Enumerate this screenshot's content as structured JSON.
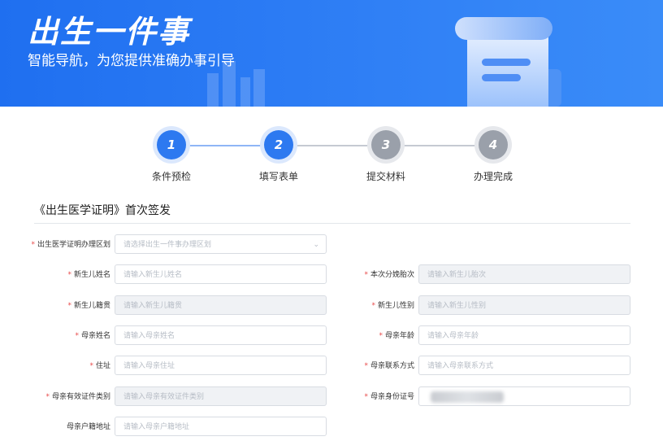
{
  "banner": {
    "title": "出生一件事",
    "subtitle": "智能导航，为您提供准确办事引导"
  },
  "steps": [
    {
      "num": "1",
      "label": "条件预检",
      "state": "active"
    },
    {
      "num": "2",
      "label": "填写表单",
      "state": "active"
    },
    {
      "num": "3",
      "label": "提交材料",
      "state": "inactive"
    },
    {
      "num": "4",
      "label": "办理完成",
      "state": "inactive"
    }
  ],
  "section": {
    "title": "《出生医学证明》首次签发"
  },
  "form": {
    "district": {
      "label": "出生医学证明办理区划",
      "placeholder": "请选择出生一件事办理区划"
    },
    "baby_name": {
      "label": "新生儿姓名",
      "placeholder": "请输入新生儿姓名"
    },
    "birth_order": {
      "label": "本次分娩胎次",
      "placeholder": "请输入新生儿胎次"
    },
    "baby_origin": {
      "label": "新生儿籍贯",
      "placeholder": "请输入新生儿籍贯"
    },
    "baby_gender": {
      "label": "新生儿性别",
      "placeholder": "请输入新生儿性别"
    },
    "mother_name": {
      "label": "母亲姓名",
      "placeholder": "请输入母亲姓名"
    },
    "mother_age": {
      "label": "母亲年龄",
      "placeholder": "请输入母亲年龄"
    },
    "address": {
      "label": "住址",
      "placeholder": "请输入母亲住址"
    },
    "mother_phone": {
      "label": "母亲联系方式",
      "placeholder": "请输入母亲联系方式"
    },
    "mother_id_type": {
      "label": "母亲有效证件类别",
      "placeholder": "请输入母亲有效证件类别"
    },
    "mother_id_no": {
      "label": "母亲身份证号",
      "placeholder": ""
    },
    "mother_hukou": {
      "label": "母亲户籍地址",
      "placeholder": "请输入母亲户籍地址"
    }
  },
  "colors": {
    "primary": "#2d79f0",
    "required": "#e84a4a",
    "inactive_step": "#9aa0aa"
  },
  "icons": {
    "banner_illustration": "scroll-document-icon",
    "select_arrow": "chevron-down-icon"
  }
}
